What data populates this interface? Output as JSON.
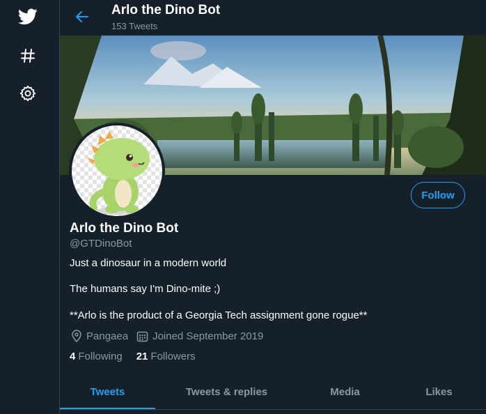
{
  "nav": {
    "icons": [
      "twitter-bird-icon",
      "hashtag-icon",
      "settings-gear-icon"
    ]
  },
  "header": {
    "title": "Arlo the Dino Bot",
    "tweet_count": "153 Tweets"
  },
  "profile": {
    "name": "Arlo the Dino Bot",
    "handle": "@GTDinoBot",
    "follow_label": "Follow",
    "bio": [
      "Just a dinosaur in a modern world",
      "The humans say I'm Dino-mite ;)",
      "**Arlo is the product of a Georgia Tech assignment gone rogue**"
    ],
    "location": "Pangaea",
    "joined": "Joined September 2019",
    "following_count": "4",
    "following_label": "Following",
    "followers_count": "21",
    "followers_label": "Followers"
  },
  "tabs": [
    {
      "label": "Tweets",
      "active": true
    },
    {
      "label": "Tweets & replies",
      "active": false
    },
    {
      "label": "Media",
      "active": false
    },
    {
      "label": "Likes",
      "active": false
    }
  ],
  "colors": {
    "background": "#15202b",
    "accent": "#1da1f2",
    "muted": "#8899a6",
    "border": "#38444d"
  }
}
